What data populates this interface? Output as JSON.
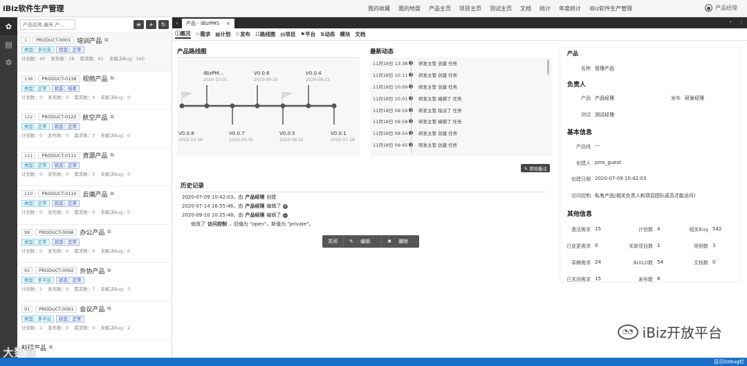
{
  "brand": "iBiz软件生产管理",
  "top_nav": [
    "我的收藏",
    "我的地盘",
    "产品主页",
    "项目主页",
    "测试主页",
    "文档",
    "统计",
    "年度统计",
    "iBiz软件生产管理"
  ],
  "user": "产品经理",
  "left_icons": [
    "products-icon",
    "list-icon",
    "settings-icon"
  ],
  "search": {
    "placeholder": "产品名称,编号,产..."
  },
  "products": [
    {
      "num": "1",
      "code": "PRODUCT-0001",
      "name": "培训产品",
      "type": "类型：多分支",
      "status": "状态：正常",
      "stats": [
        "计划数：40",
        "发布数：28",
        "需求数：61",
        "未解决Bug：160"
      ]
    },
    {
      "num": "138",
      "code": "PRODUCT-0138",
      "name": "视频产品",
      "type": "类型：正常",
      "status": "状态：结束",
      "stats": [
        "计划数：0",
        "发布数：0",
        "需求数：0",
        "未解决Bug：0"
      ]
    },
    {
      "num": "122",
      "code": "PRODUCT-0122",
      "name": "航空产品",
      "type": "类型：正常",
      "status": "状态：正常",
      "stats": [
        "计划数：0",
        "发布数：0",
        "需求数：3",
        "未解决Bug：0"
      ]
    },
    {
      "num": "111",
      "code": "PRODUCT-0111",
      "name": "资源产品",
      "type": "类型：正常",
      "status": "状态：正常",
      "stats": [
        "计划数：0",
        "发布数：0",
        "需求数：0",
        "未解决Bug：0"
      ]
    },
    {
      "num": "110",
      "code": "PRODUCT-0110",
      "name": "云端产品",
      "type": "类型：正常",
      "status": "状态：正常",
      "stats": [
        "计划数：0",
        "发布数：0",
        "需求数：0",
        "未解决Bug：0"
      ]
    },
    {
      "num": "98",
      "code": "PRODUCT-0098",
      "name": "办公产品",
      "type": "类型：正常",
      "status": "状态：正常",
      "stats": [
        "计划数：0",
        "发布数：0",
        "需求数：0",
        "未解决Bug：0"
      ]
    },
    {
      "num": "92",
      "code": "PRODUCT-0092",
      "name": "外协产品",
      "type": "类型：多平台",
      "status": "状态：正常",
      "stats": [
        "计划数：1",
        "发布数：0",
        "需求数：7",
        "未解决Bug：3"
      ]
    },
    {
      "num": "91",
      "code": "PRODUCT-0091",
      "name": "会议产品",
      "type": "类型：多平台",
      "status": "状态：正常",
      "stats": [
        "计划数：1",
        "发布数：0",
        "需求数：0",
        "未解决Bug：2"
      ]
    },
    {
      "num": "",
      "code": "",
      "name": "科研产品",
      "type": "",
      "status": "",
      "stats": []
    }
  ],
  "tab": {
    "label": "产品 - iBizPMS",
    "close": "×"
  },
  "subnav": [
    "概况",
    "需求",
    "计划",
    "发布",
    "路线图",
    "项目",
    "平台",
    "动态",
    "模块",
    "文档"
  ],
  "roadmap": {
    "title": "产品路线图",
    "top": [
      {
        "v": "iBizPM...",
        "d": "2020-10-01"
      },
      {
        "v": "V0.0.6",
        "d": "2020-09-20"
      },
      {
        "v": "V0.0.4",
        "d": "2020-08-22"
      }
    ],
    "bottom": [
      {
        "v": "V0.0.8",
        "d": "2020-10-18"
      },
      {
        "v": "V0.0.7",
        "d": "2020-09-30"
      },
      {
        "v": "V0.0.5",
        "d": "2020-08-31"
      },
      {
        "v": "V0.0.1",
        "d": "2020-07-18"
      }
    ]
  },
  "news": {
    "title": "最新动态",
    "items": [
      {
        "t": "11月18日 13:38",
        "c": "研发主管 创建 任务"
      },
      {
        "t": "11月18日 10:11",
        "c": "研发主管 创建 任务"
      },
      {
        "t": "11月18日 10:09",
        "c": "研发主管 创建 任务"
      },
      {
        "t": "11月18日 10:01",
        "c": "研发主管 编辑了 任务"
      },
      {
        "t": "11月18日 09:59",
        "c": "研发主管 指派了 任务"
      },
      {
        "t": "11月18日 09:58",
        "c": "研发主管 编辑了 任务"
      },
      {
        "t": "11月18日 09:54",
        "c": "研发主管 创建 任务"
      },
      {
        "t": "11月18日 09:45",
        "c": "研发主管 创建 任务"
      }
    ]
  },
  "history": {
    "add_note": "添加备注",
    "title": "历史记录",
    "rows": [
      {
        "a": "2020-07-09 10:42:03，由",
        "b": "产品经理",
        "c": "创建"
      },
      {
        "a": "2020-07-14 16:55:46，由",
        "b": "产品经理",
        "c": "编辑了"
      },
      {
        "a": "2020-09-10 10:25:48，由",
        "b": "产品经理",
        "c": "编辑了"
      }
    ],
    "detail_a": "修改了",
    "detail_b": "访问控制",
    "detail_c": "，旧值为 \"open\"，新值为 \"private\"。"
  },
  "actions": {
    "close": "关闭",
    "edit": "编辑",
    "delete": "删除"
  },
  "info": {
    "product_label": "产品",
    "name_k": "名称",
    "name_v": "管理产品",
    "owner_title": "负责人",
    "owner_prod_k": "产品",
    "owner_prod_v": "产品经理",
    "owner_rel_k": "发布",
    "owner_rel_v": "研发经理",
    "owner_test_k": "测试",
    "owner_test_v": "测试经理",
    "basic_title": "基本信息",
    "line_k": "产品线",
    "line_v": "---",
    "creator_k": "创建人",
    "creator_v": "pms_guest",
    "date_k": "创建日期",
    "date_v": "2020-07-09 10:42:03",
    "acl_k": "访问控制",
    "acl_v": "私有产品(相关负责人和项目团队成员才能访问)",
    "other_title": "其他信息",
    "other": [
      [
        "激活需求",
        "15",
        "计划数",
        "4",
        "相关Bug",
        "542"
      ],
      [
        "已变更需求",
        "0",
        "关联项目数",
        "1",
        "用例数",
        "3"
      ],
      [
        "草稿需求",
        "24",
        "BUILD数",
        "54",
        "文档数",
        "0"
      ],
      [
        "已关闭需求",
        "15",
        "发布数",
        "8",
        "",
        ""
      ]
    ]
  },
  "debug": "显示Debug栏",
  "watermark": "iBiz开放平台",
  "watermark2": "大数据"
}
